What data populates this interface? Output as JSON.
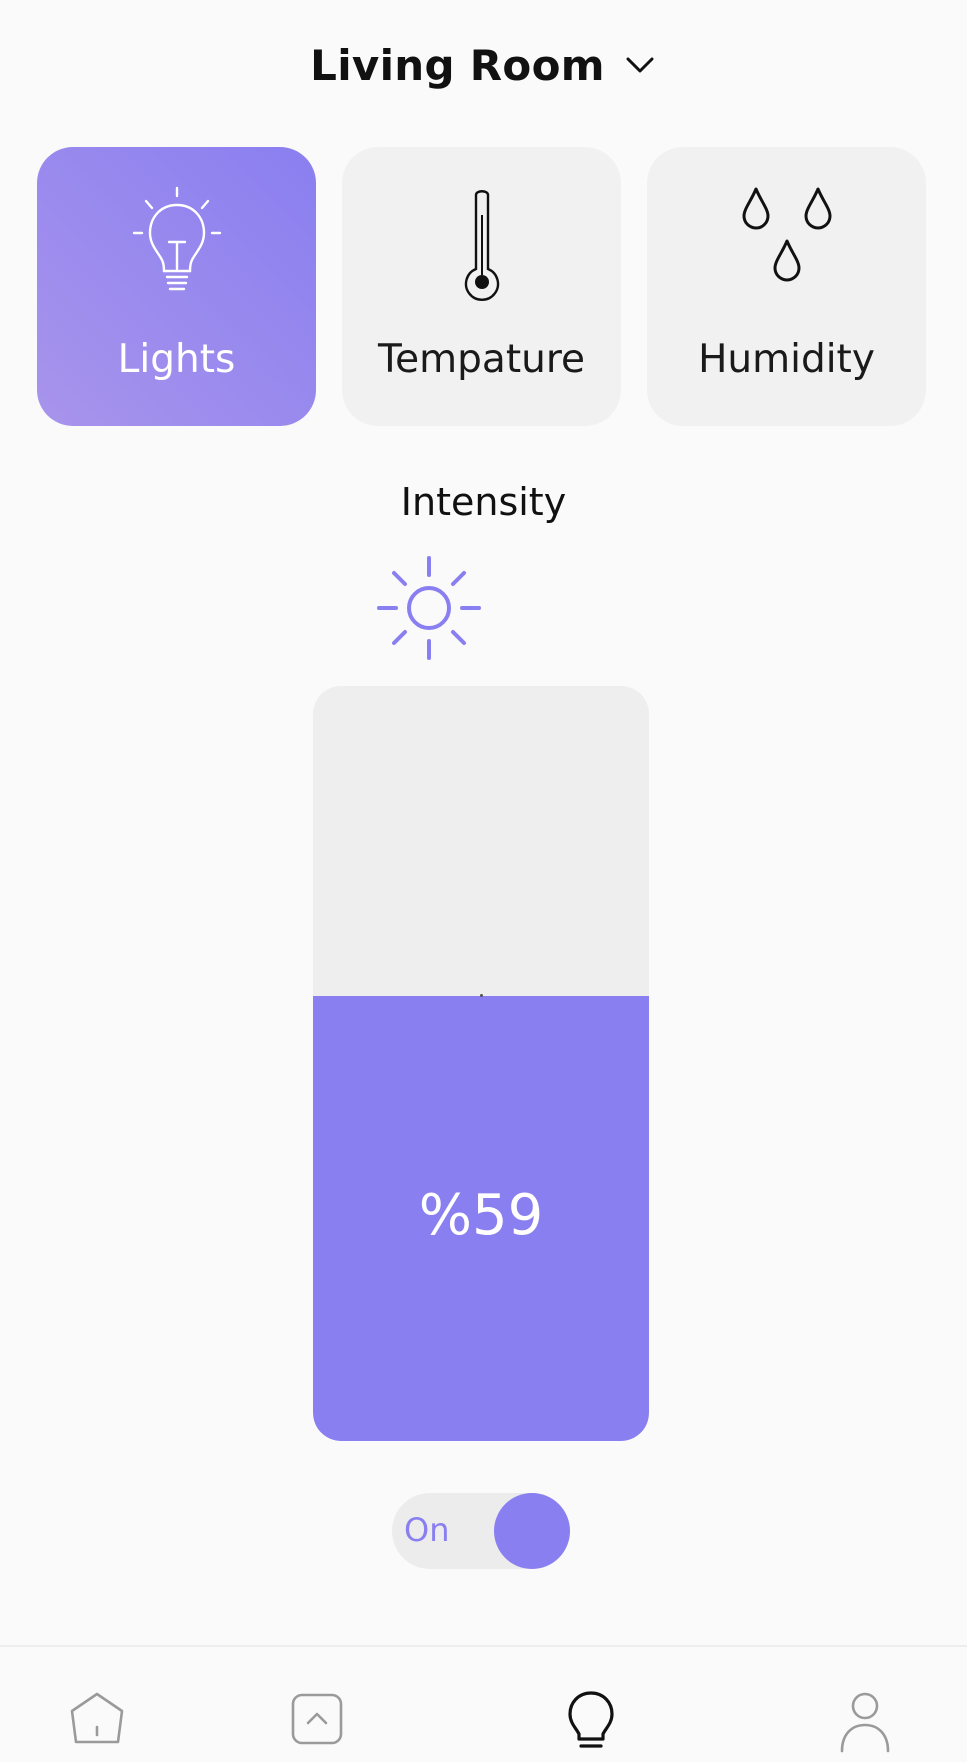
{
  "header": {
    "room": "Living Room",
    "dropdown_icon": "chevron-down-icon"
  },
  "categories": [
    {
      "label": "Lights",
      "icon": "lightbulb-icon",
      "active": true
    },
    {
      "label": "Tempature",
      "icon": "thermometer-icon",
      "active": false
    },
    {
      "label": "Humidity",
      "icon": "droplets-icon",
      "active": false
    }
  ],
  "intensity": {
    "label": "Intensity",
    "icon": "sun-icon",
    "value": 59,
    "value_text": "%59"
  },
  "toggle": {
    "label": "On",
    "state": true
  },
  "nav": [
    {
      "name": "home-icon"
    },
    {
      "name": "arrow-up-box-icon"
    },
    {
      "name": "lightbulb-icon",
      "active": true
    },
    {
      "name": "user-icon"
    }
  ],
  "colors": {
    "accent": "#8a7ff0",
    "card_bg": "#f1f1f1",
    "slider_track": "#eeeeee",
    "page_bg": "#fafafa"
  }
}
